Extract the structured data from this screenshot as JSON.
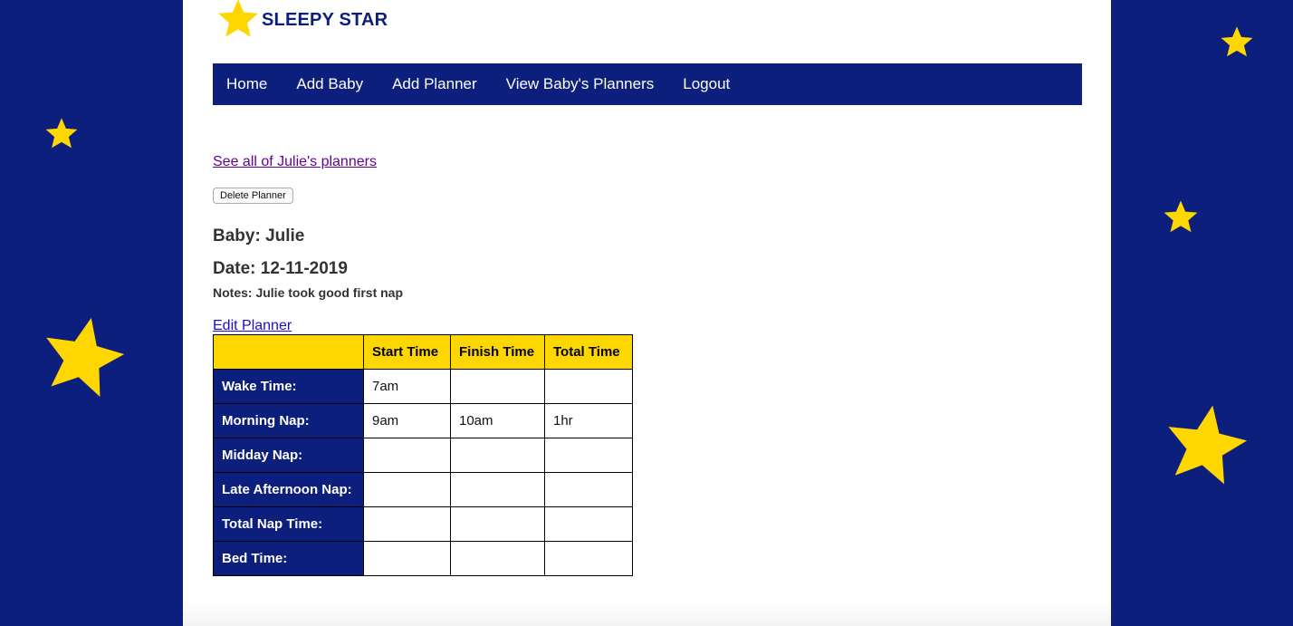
{
  "brand": {
    "name": "SLEEPY STAR",
    "logo_icon": "star-icon",
    "star_color": "#ffd700",
    "navy": "#0d1f7d"
  },
  "nav": {
    "items": [
      {
        "label": "Home"
      },
      {
        "label": "Add Baby"
      },
      {
        "label": "Add Planner"
      },
      {
        "label": "View Baby's Planners"
      },
      {
        "label": "Logout"
      }
    ]
  },
  "links": {
    "see_all": "See all of Julie's planners",
    "edit": "Edit Planner"
  },
  "buttons": {
    "delete": "Delete Planner"
  },
  "planner": {
    "baby": "Baby: Julie",
    "date": "Date: 12-11-2019",
    "notes": "Notes: Julie took good first nap",
    "headers": [
      "",
      "Start Time",
      "Finish Time",
      "Total Time"
    ],
    "rows": [
      {
        "label": "Wake Time:",
        "start": "7am",
        "finish": "",
        "total": ""
      },
      {
        "label": "Morning Nap:",
        "start": "9am",
        "finish": "10am",
        "total": "1hr"
      },
      {
        "label": "Midday Nap:",
        "start": "",
        "finish": "",
        "total": ""
      },
      {
        "label": "Late Afternoon Nap:",
        "start": "",
        "finish": "",
        "total": ""
      },
      {
        "label": "Total Nap Time:",
        "start": "",
        "finish": "",
        "total": ""
      },
      {
        "label": "Bed Time:",
        "start": "",
        "finish": "",
        "total": ""
      }
    ]
  }
}
